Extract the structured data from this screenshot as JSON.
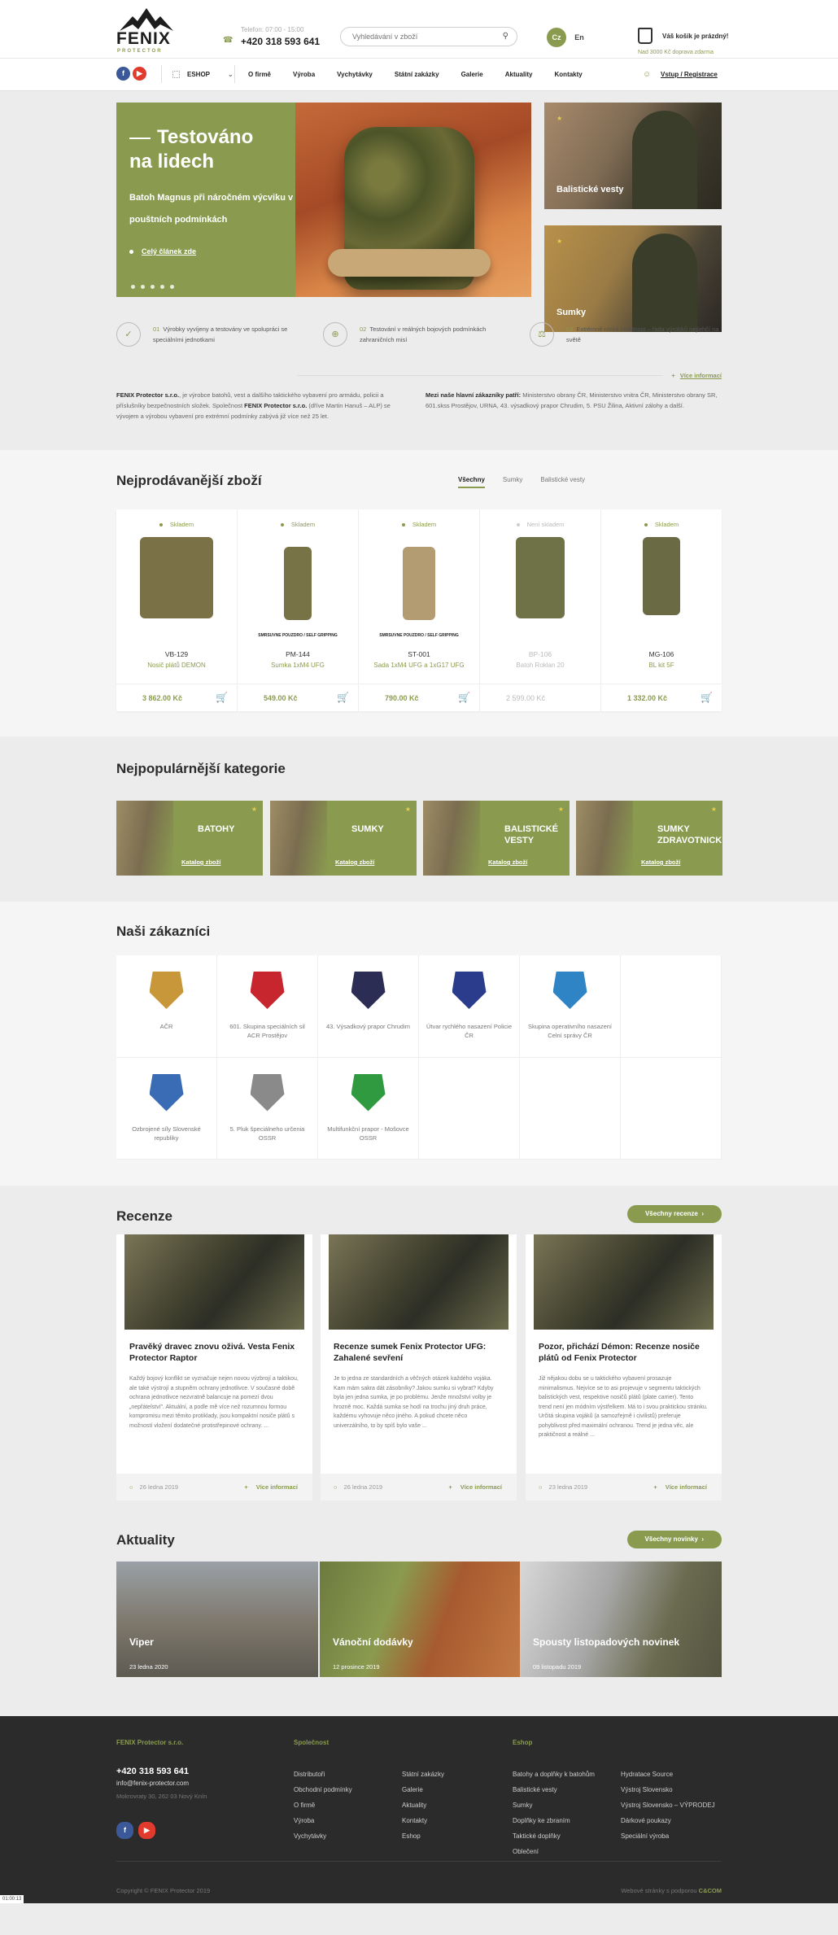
{
  "header": {
    "logo": "FENIX",
    "logo_sub": "PROTECTOR",
    "phone_hours": "Telefon: 07:00 - 15:00",
    "phone": "+420 318 593 641",
    "search_placeholder": "Vyhledávání v zboží",
    "lang_cs": "Cz",
    "lang_en": "En",
    "cart_title": "Váš košík je prázdný!",
    "cart_note": "Nad 3000 Kč doprava zdarma"
  },
  "nav": {
    "eshop": "ESHOP",
    "items": [
      "O firmě",
      "Výroba",
      "Vychytávky",
      "Státní zakázky",
      "Galerie",
      "Aktuality",
      "Kontakty"
    ],
    "login": "Vstup / Registrace"
  },
  "hero": {
    "title1": "Testováno",
    "title2": "na lidech",
    "text": "Batoh Magnus při náročném výcviku v pouštních podmínkách",
    "link": "Celý článek zde",
    "tiles": [
      "Balistické vesty",
      "Sumky"
    ]
  },
  "features": [
    {
      "num": "01",
      "text": "Výrobky vyvíjeny a testovány ve spolupráci se speciálními jednotkami"
    },
    {
      "num": "02",
      "text": "Testování v reálných bojových podmínkách zahraničních misí"
    },
    {
      "num": "03",
      "text": "Extrémně nízká hmotnost – řada výrobků nejlehčí na světě"
    }
  ],
  "info": {
    "more": "Více informací",
    "left_b1": "FENIX Protector s.r.o.",
    "left_t1": ", je výrobce batohů, vest a dalšího taktického vybavení pro armádu, policii a příslušníky bezpečnostních složek. Společnost ",
    "left_b2": "FENIX Protector s.r.o.",
    "left_t2": " (dříve Martin Hanuš – ALP) se vývojem a výrobou vybavení pro extrémní podmínky zabývá již více než 25 let.",
    "right_b": "Mezi naše hlavní zákazníky patří:",
    "right_t": " Ministerstvo obrany ČR, Ministerstvo vnitra ČR, Ministerstvo obrany SR, 601.skss Prostějov, URNA, 43. výsadkový prapor Chrudim, 5. PSU Žilina, Aktivní zálohy a další."
  },
  "bestsellers": {
    "title": "Nejprodávanější zboží",
    "tabs": [
      "Všechny",
      "Sumky",
      "Balistické vesty"
    ],
    "products": [
      {
        "stock": "Skladem",
        "brand": "",
        "code": "VB-129",
        "name": "Nosič plátů DEMON",
        "price": "3 862.00 Kč",
        "img": "#7a7246"
      },
      {
        "stock": "Skladem",
        "brand": "SMRSUVNE POUZDRO / SELF GRIPPING",
        "code": "PM-144",
        "name": "Sumka 1xM4 UFG",
        "price": "549.00 Kč",
        "img": "#777346"
      },
      {
        "stock": "Skladem",
        "brand": "SMRSUVNE POUZDRO / SELF GRIPPING",
        "code": "ST-001",
        "name": "Sada 1xM4 UFG a 1xG17 UFG",
        "price": "790.00 Kč",
        "img": "#b39b72"
      },
      {
        "stock": "Není skladem",
        "brand": "",
        "code": "BP-106",
        "name": "Batoh Roklan 20",
        "price": "2 599.00 Kč",
        "img": "#6e7246"
      },
      {
        "stock": "Skladem",
        "brand": "",
        "code": "MG-106",
        "name": "BL kit 5F",
        "price": "1 332.00 Kč",
        "img": "#6a6a44"
      }
    ]
  },
  "categories": {
    "title": "Nejpopulárnější kategorie",
    "link": "Katalog zboží",
    "items": [
      "BATOHY",
      "SUMKY",
      "BALISTICKÉ VESTY",
      "SUMKY ZDRAVOTNICKÉ"
    ]
  },
  "customers": {
    "title": "Naši zákazníci",
    "items": [
      {
        "name": "AČR",
        "color": "#c8973a"
      },
      {
        "name": "601. Skupina speciálních sil ACR Prostějov",
        "color": "#c8262e"
      },
      {
        "name": "43. Výsadkový prapor Chrudim",
        "color": "#2b2d55"
      },
      {
        "name": "Útvar rychlého nasazení Policie ČR",
        "color": "#2b3c8c"
      },
      {
        "name": "Skupina operativního nasazení Celní správy ČR",
        "color": "#2e84c4"
      },
      {
        "name": "",
        "color": ""
      },
      {
        "name": "Ozbrojené síly Slovenské republiky",
        "color": "#3a6bb5"
      },
      {
        "name": "5. Pluk špeciálneho určenia OSSR",
        "color": "#8a8a8a"
      },
      {
        "name": "Multifunkční prapor - Mošovce OSSR",
        "color": "#2f9a3f"
      },
      {
        "name": "",
        "color": ""
      },
      {
        "name": "",
        "color": ""
      },
      {
        "name": "",
        "color": ""
      }
    ]
  },
  "reviews": {
    "title": "Recenze",
    "all": "Všechny recenze",
    "items": [
      {
        "title": "Pravěký dravec znovu oživá. Vesta Fenix Protector Raptor",
        "text": "Každý bojový konflikt se vyznačuje nejen novou výzbrojí a taktikou, ale také výstrojí a stupněm ochrany jednotlivce. V současné době ochrana jednotlivce nezvratně balancuje na pomezí dvou „nepřátelství\". Aktuální, a podle mě více než rozumnou formou kompromisu mezi těmito protiklady, jsou kompaktní nosiče plátů s možností vložení dodatečné protistřepinové ochrany. ...",
        "date": "26 ledna 2019",
        "more": "Více informací"
      },
      {
        "title": "Recenze sumek Fenix Protector UFG: Zahalené sevření",
        "text": "Je to jedna ze standardních a věčných otázek každého vojáka. Kam mám sakra dát zásobníky? Jakou sumku si vybrat? Kdyby byla jen jedna sumka, je po problému. Jenže množství volby je hrozně moc. Každá sumka se hodí na trochu jiný druh práce, každému vyhovuje něco jiného. A pokud chcete něco univerzálního, to by spíš bylo vaše ...",
        "date": "26 ledna 2019",
        "more": "Více informací"
      },
      {
        "title": "Pozor, přichází Démon: Recenze nosiče plátů od Fenix Protector",
        "text": "Již nějakou dobu se u taktického vybavení prosazuje minimalismus. Nejvíce se to asi projevuje v segmentu taktických balistických vest, respektive nosičů plátů (plate carrier). Tento trend není jen módním výstřelkem. Má to i svou praktickou stránku. Určitá skupina vojáků (a samozřejmě i civilistů) preferuje pohyblivost před maximální ochranou. Trend je jedna věc, ale praktičnost a reálné ...",
        "date": "23 ledna 2019",
        "more": "Více informací"
      }
    ]
  },
  "news": {
    "title": "Aktuality",
    "all": "Všechny novinky",
    "items": [
      {
        "title": "Viper",
        "date": "23 ledna 2020"
      },
      {
        "title": "Vánoční dodávky",
        "date": "12 prosince 2019"
      },
      {
        "title": "Spousty listopadových novinek",
        "date": "09 listopadu 2019"
      }
    ]
  },
  "footer": {
    "company": "FENIX Protector s.r.o.",
    "phone": "+420 318 593 641",
    "email": "info@fenix-protector.com",
    "address": "Mokrovraty 30, 262 03 Nový Knín",
    "col_company_title": "Společnost",
    "col1": [
      "Distributoři",
      "Obchodní podmínky",
      "O firmě",
      "Výroba",
      "Vychytávky"
    ],
    "col2": [
      "Státní zakázky",
      "Galerie",
      "Aktuality",
      "Kontakty",
      "Eshop"
    ],
    "col_eshop_title": "Eshop",
    "col3": [
      "Batohy a doplňky k batohům",
      "Balistické vesty",
      "Sumky",
      "Doplňky ke zbraním",
      "Taktické doplňky",
      "Oblečení"
    ],
    "col4": [
      "Hydratace Source",
      "Výstroj Slovensko",
      "Výstroj Slovensko – VÝPRODEJ",
      "Dárkové poukazy",
      "Speciální výroba"
    ],
    "copyright": "Copyright © FENIX Protector 2019",
    "credit_text": "Webové stránky s podporou",
    "credit_brand": "C&COM"
  },
  "badge": "01:00:13",
  "colors": {
    "accent": "#8a9b4f",
    "dark": "#2b2b2b",
    "facebook": "#3b5998",
    "youtube": "#e23b2e"
  }
}
